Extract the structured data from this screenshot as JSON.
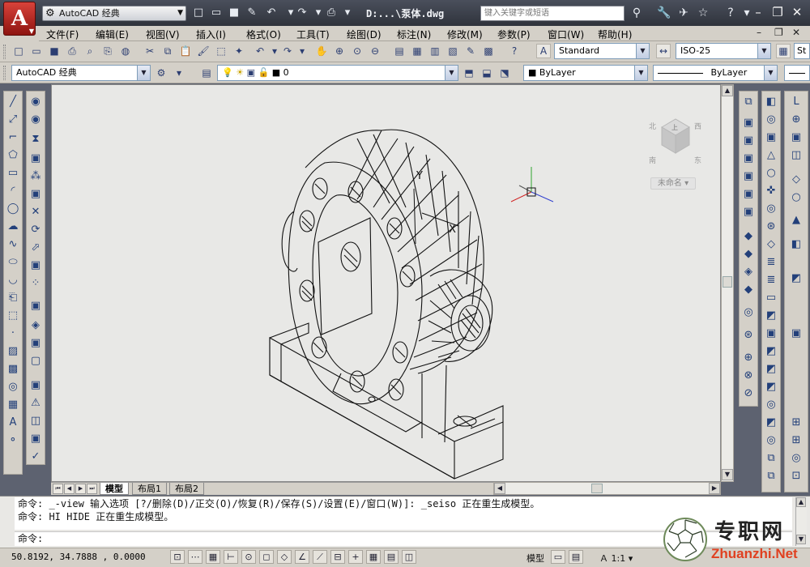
{
  "app": {
    "logo_letter": "A",
    "workspace": "AutoCAD 经典",
    "doc_title": "D:...\\泵体.dwg"
  },
  "search": {
    "placeholder": "键入关键字或短语"
  },
  "menu": [
    "文件(F)",
    "编辑(E)",
    "视图(V)",
    "插入(I)",
    "格式(O)",
    "工具(T)",
    "绘图(D)",
    "标注(N)",
    "修改(M)",
    "参数(P)",
    "窗口(W)",
    "帮助(H)"
  ],
  "styles_toolbar": {
    "text_style": "Standard",
    "dim_style": "ISO-25",
    "table_style_prefix": "St"
  },
  "layers_toolbar": {
    "workspace": "AutoCAD 经典",
    "layer_name": "0"
  },
  "properties_toolbar": {
    "color": "ByLayer",
    "linetype": "ByLayer"
  },
  "viewcube": {
    "label": "未命名",
    "top_label": "上",
    "faces": [
      "北",
      "西",
      "东",
      "南"
    ]
  },
  "ucs": {
    "x": "X",
    "y": "Y"
  },
  "tabs": [
    "模型",
    "布局1",
    "布局2"
  ],
  "command": {
    "history": [
      "命令: _-view 输入选项 [?/删除(D)/正交(O)/恢复(R)/保存(S)/设置(E)/窗口(W)]: _seiso 正在重生成模型。",
      "命令: HI HIDE 正在重生成模型。"
    ],
    "prompt": "命令:"
  },
  "status": {
    "coords": "50.8192,  34.7888 , 0.0000",
    "space": "模型",
    "scale": "1:1"
  },
  "watermark": {
    "title": "专职网",
    "url": "Zhuanzhi.Net"
  }
}
